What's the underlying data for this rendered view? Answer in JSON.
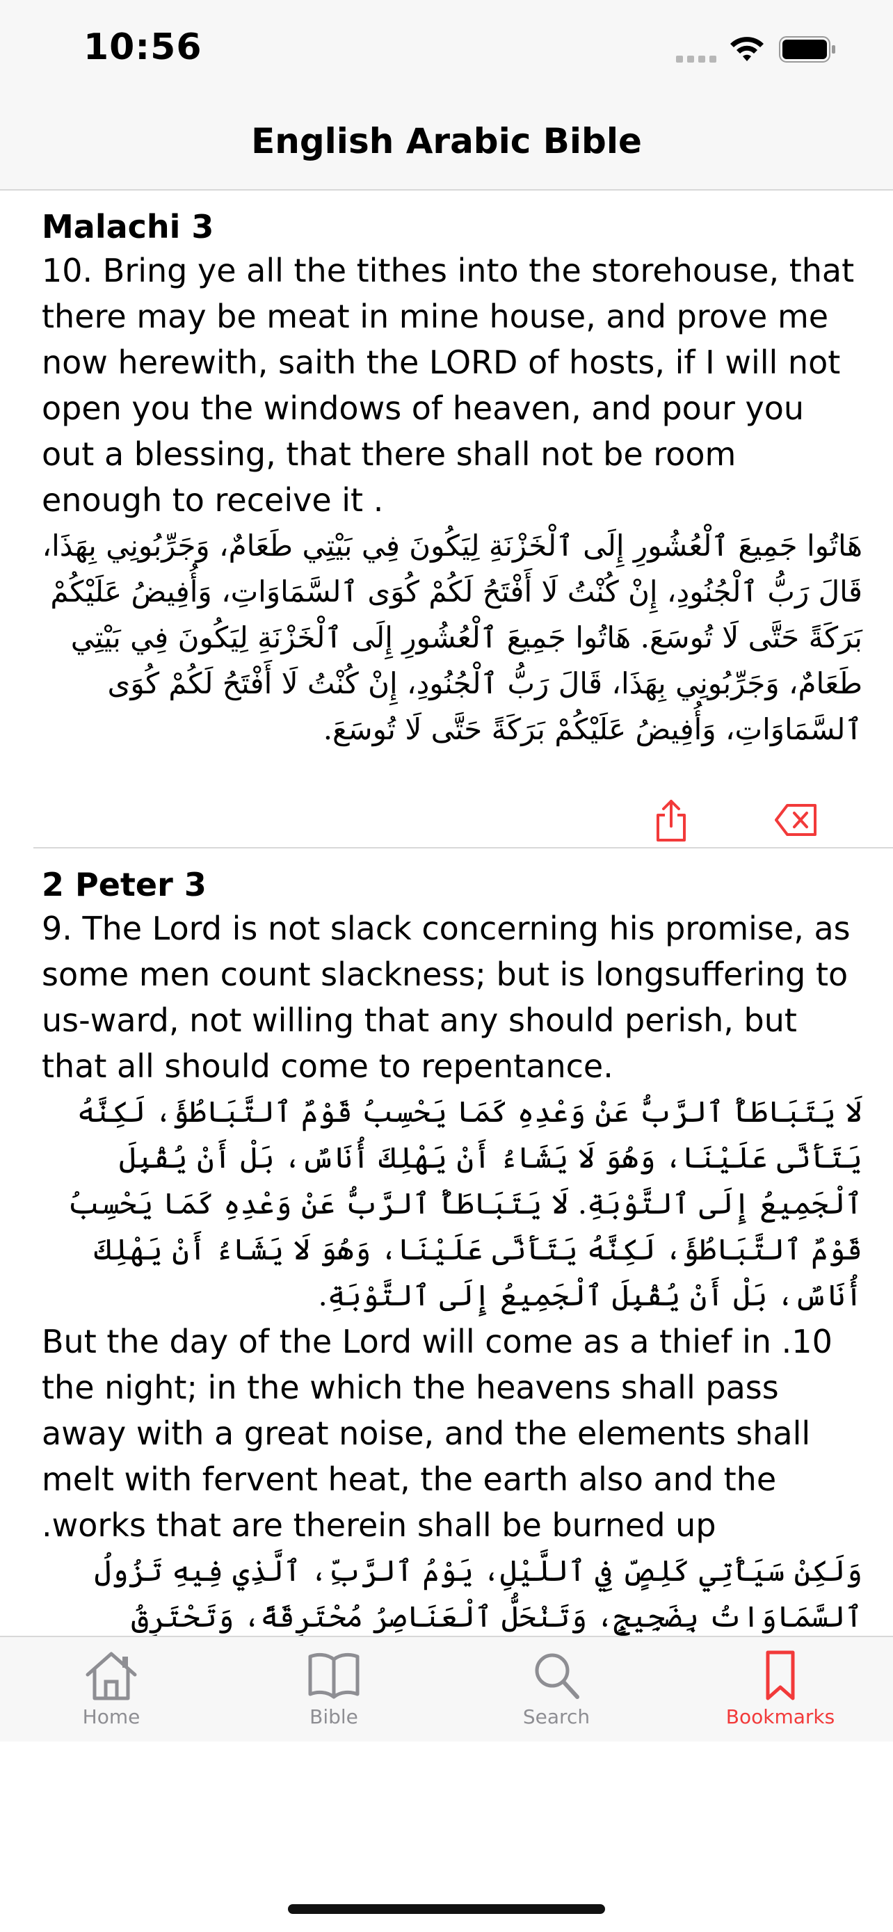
{
  "status_bar": {
    "time": "10:56"
  },
  "nav": {
    "title": "English Arabic Bible"
  },
  "bookmarks": [
    {
      "reference": "Malachi 3",
      "english": "10. Bring ye all the tithes into the storehouse, that there may be meat in mine house, and prove me now herewith, saith the LORD of hosts, if I will not open you the windows of heaven, and pour you out a blessing, that there shall not be room enough to receive it .",
      "arabic": "هَاتُوا جَمِيعَ ٱلْعُشُورِ إِلَى ٱلْخَزْنَةِ لِيَكُونَ فِي بَيْتِي طَعَامٌ، وَجَرِّبُونِي بِهَذَا، قَالَ رَبُّ ٱلْجُنُودِ، إِنْ كُنْتُ لَا أَفْتَحُ لَكُمْ كُوَى ٱلسَّمَاوَاتِ، وَأُفِيضُ عَلَيْكُمْ بَرَكَةً حَتَّى لَا تُوسَعَ. هَاتُوا جَمِيعَ ٱلْعُشُورِ إِلَى ٱلْخَزْنَةِ لِيَكُونَ فِي بَيْتِي طَعَامٌ، وَجَرِّبُونِي بِهَذَا، قَالَ رَبُّ ٱلْجُنُودِ، إِنْ كُنْتُ لَا أَفْتَحُ لَكُمْ كُوَى ٱلسَّمَاوَاتِ، وَأُفِيضُ عَلَيْكُمْ بَرَكَةً حَتَّى لَا تُوسَعَ."
    },
    {
      "reference": "2 Peter 3",
      "english": "9. The Lord is not slack concerning his promise, as some men count slackness; but is longsuffering to us-ward, not willing that any should perish, but that all should come to repentance.",
      "arabic": "لَا يَتَبَاطَأُ ٱلرَّبُّ عَنْ وَعْدِهِ كَمَا يَحْسِبُ قَوْمٌ ٱلتَّبَاطُؤَ، لَكِنَّهُ يَتَأَنَّى عَلَيْنَا، وَهُوَ لَا يَشَاءُ أَنْ يَهْلِكَ أُنَاسٌ، بَلْ أَنْ يُقْبِلَ ٱلْجَمِيعُ إِلَى ٱلتَّوْبَةِ. لَا يَتَبَاطَأُ ٱلرَّبُّ عَنْ وَعْدِهِ كَمَا يَحْسِبُ قَوْمٌ ٱلتَّبَاطُؤَ، لَكِنَّهُ يَتَأَنَّى عَلَيْنَا، وَهُوَ لَا يَشَاءُ أَنْ يَهْلِكَ أُنَاسٌ، بَلْ أَنْ يُقْبِلَ ٱلْجَمِيعُ إِلَى ٱلتَّوْبَةِ.",
      "english_2": "10. But the day of the Lord will come as a thief in the night; in the which the heavens shall pass away with a great noise, and the elements shall melt with fervent heat, the earth also and the works that are therein shall be burned up.",
      "arabic_2": "وَلَكِنْ سَيَأْتِي كَلِصٍّ فِي ٱللَّيْلِ، يَوْمُ ٱلرَّبِّ، ٱلَّذِي فِيهِ تَزُولُ ٱلسَّمَاوَاتُ بِضَجِيجٍ، وَتَنْحَلُّ ٱلْعَنَاصِرُ مُحْتَرِقَةً، وَتَحْتَرِقُ ٱلْأَرْضُ"
    }
  ],
  "tabs": [
    {
      "label": "Home",
      "icon": "house-icon"
    },
    {
      "label": "Bible",
      "icon": "book-icon"
    },
    {
      "label": "Search",
      "icon": "magnifier-icon"
    },
    {
      "label": "Bookmarks",
      "icon": "bookmark-icon"
    }
  ],
  "colors": {
    "accent": "#f23a3a",
    "inactive": "#8e8e93"
  }
}
